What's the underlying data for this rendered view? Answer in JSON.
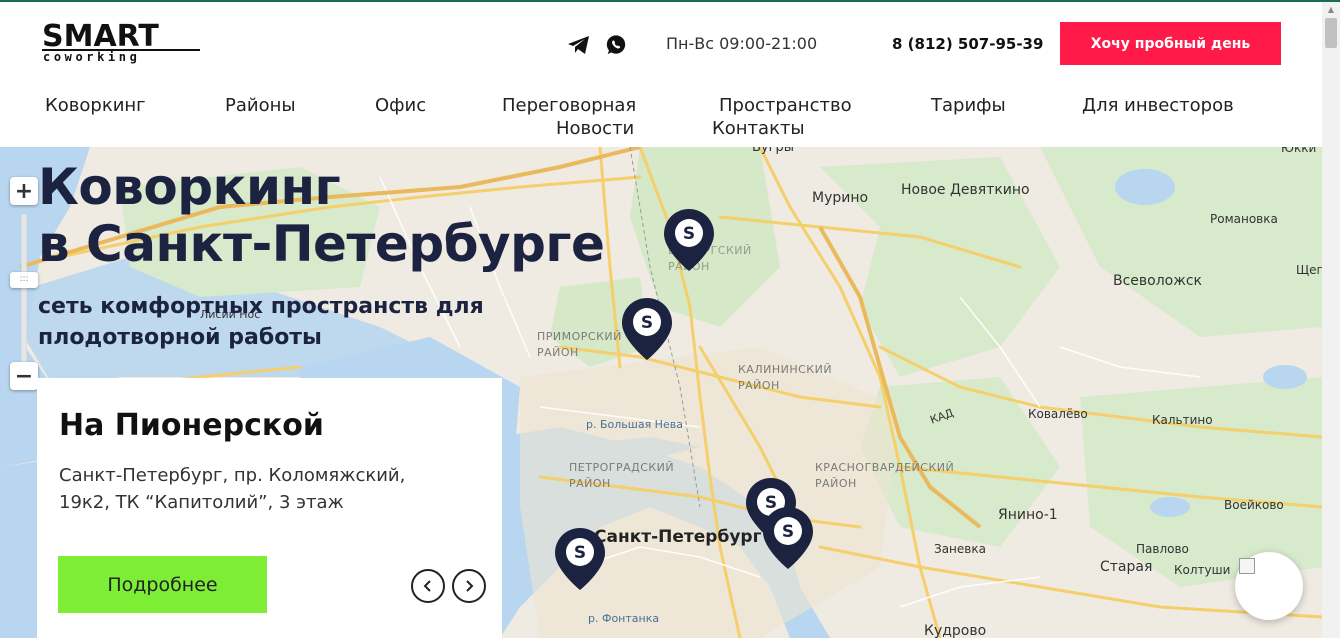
{
  "header": {
    "logo": {
      "word": "SMART",
      "sub": "coworking"
    },
    "hours": "Пн-Вс 09:00-21:00",
    "phone": "8 (812) 507-95-39",
    "cta_label": "Хочу пробный день",
    "social": [
      {
        "icon": "telegram-icon"
      },
      {
        "icon": "whatsapp-icon"
      }
    ]
  },
  "nav": [
    {
      "label": "Коворкинг"
    },
    {
      "label": "Районы"
    },
    {
      "label": "Офис"
    },
    {
      "label": "Переговорная"
    },
    {
      "label": "Пространство"
    },
    {
      "label": "Тарифы"
    },
    {
      "label": "Для инвесторов"
    },
    {
      "label": "Новости"
    },
    {
      "label": "Контакты"
    }
  ],
  "hero": {
    "title_line1": "Коворкинг",
    "title_line2": "в Санкт-Петербурге",
    "subtitle_line1": "сеть комфортных пространств для",
    "subtitle_line2": "плодотворной работы"
  },
  "card": {
    "title": "На Пионерской",
    "address": "Санкт-Петербург, пр. Коломяжский, 19к2, ТК “Капитолий”, 3 этаж",
    "button_label": "Подробнее"
  },
  "map": {
    "zoom_in": "+",
    "zoom_out": "−",
    "labels": [
      {
        "text": "Мурино"
      },
      {
        "text": "Новое Девяткино"
      },
      {
        "text": "Всеволожск"
      },
      {
        "text": "Романовка"
      },
      {
        "text": "Ковалёво"
      },
      {
        "text": "Кальтино"
      },
      {
        "text": "Янино-1"
      },
      {
        "text": "Заневка"
      },
      {
        "text": "Павлово"
      },
      {
        "text": "Старая"
      },
      {
        "text": "Колтуши"
      },
      {
        "text": "Воейково"
      },
      {
        "text": "Кудрово"
      },
      {
        "text": "Бугры"
      },
      {
        "text": "Юкки"
      },
      {
        "text": "Щеглово"
      },
      {
        "text": "Лисий Нос"
      },
      {
        "text": "ПРИМОРСКИЙ РАЙОН"
      },
      {
        "text": "КАЛИНИНСКИЙ РАЙОН"
      },
      {
        "text": "ПЕТРОГРАДСКИЙ РАЙОН"
      },
      {
        "text": "КРАСНОГВАРДЕЙСКИЙ РАЙОН"
      },
      {
        "text": "ВЫБОРГСКИЙ РАЙОН"
      },
      {
        "text": "Санкт-Петербург"
      },
      {
        "text": "р. Большая Нева"
      },
      {
        "text": "р. Фонтанка"
      },
      {
        "text": "КАД"
      }
    ],
    "pin_letter": "S"
  },
  "colors": {
    "cta": "#ff1a4a",
    "card_button": "#7ded36",
    "title_navy": "#1c2340",
    "pin": "#1c2340"
  }
}
